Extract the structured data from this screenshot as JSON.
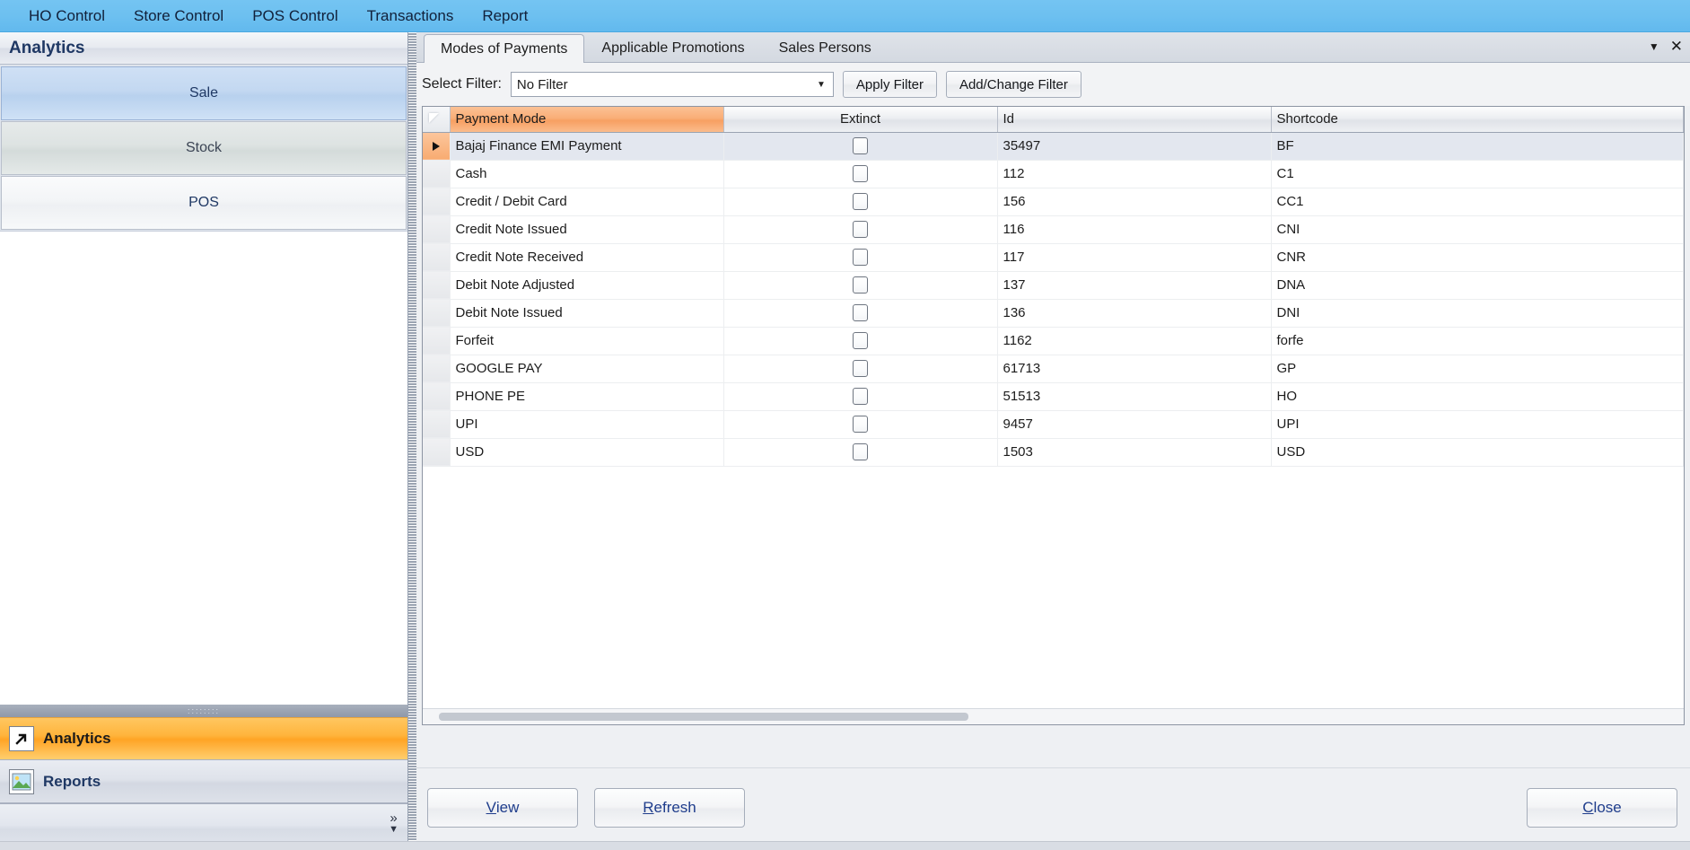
{
  "menubar": {
    "items": [
      {
        "label": "HO Control"
      },
      {
        "label": "Store Control"
      },
      {
        "label": "POS Control"
      },
      {
        "label": "Transactions"
      },
      {
        "label": "Report"
      }
    ]
  },
  "sidebar": {
    "title": "Analytics",
    "nav": [
      {
        "label": "Sale",
        "state": "selected"
      },
      {
        "label": "Stock",
        "state": "normal"
      },
      {
        "label": "POS",
        "state": "normal"
      }
    ],
    "panels": [
      {
        "label": "Analytics",
        "icon": "arrow-up-right-icon",
        "state": "active"
      },
      {
        "label": "Reports",
        "icon": "picture-icon",
        "state": "inactive"
      }
    ],
    "overflow_icon": "double-chevron-right-icon",
    "overflow_dropdown_icon": "chevron-down-icon"
  },
  "tabs": {
    "items": [
      {
        "label": "Modes of Payments",
        "active": true
      },
      {
        "label": "Applicable Promotions",
        "active": false
      },
      {
        "label": "Sales Persons",
        "active": false
      }
    ],
    "window_controls": [
      {
        "icon": "chevron-down-icon",
        "glyph": "▼"
      },
      {
        "icon": "close-icon",
        "glyph": "✕"
      }
    ]
  },
  "filter_bar": {
    "label": "Select Filter:",
    "select_value": "No Filter",
    "select_placeholder": "No Filter",
    "dropdown_icon": "chevron-down-icon",
    "apply_label": "Apply Filter",
    "add_change_label": "Add/Change Filter"
  },
  "grid": {
    "columns": [
      {
        "label": "Payment Mode",
        "align": "left",
        "accent": true
      },
      {
        "label": "Extinct",
        "align": "center",
        "accent": false
      },
      {
        "label": "Id",
        "align": "left",
        "accent": false
      },
      {
        "label": "Shortcode",
        "align": "left",
        "accent": false
      }
    ],
    "rows": [
      {
        "payment_mode": "Bajaj Finance EMI Payment",
        "extinct": false,
        "id": "35497",
        "shortcode": "BF",
        "selected": true
      },
      {
        "payment_mode": "Cash",
        "extinct": false,
        "id": "112",
        "shortcode": "C1",
        "selected": false
      },
      {
        "payment_mode": "Credit / Debit Card",
        "extinct": false,
        "id": "156",
        "shortcode": "CC1",
        "selected": false
      },
      {
        "payment_mode": "Credit Note Issued",
        "extinct": false,
        "id": "116",
        "shortcode": "CNI",
        "selected": false
      },
      {
        "payment_mode": "Credit Note Received",
        "extinct": false,
        "id": "117",
        "shortcode": "CNR",
        "selected": false
      },
      {
        "payment_mode": "Debit Note Adjusted",
        "extinct": false,
        "id": "137",
        "shortcode": "DNA",
        "selected": false
      },
      {
        "payment_mode": "Debit Note Issued",
        "extinct": false,
        "id": "136",
        "shortcode": "DNI",
        "selected": false
      },
      {
        "payment_mode": "Forfeit",
        "extinct": false,
        "id": "1162",
        "shortcode": "forfe",
        "selected": false
      },
      {
        "payment_mode": "GOOGLE PAY",
        "extinct": false,
        "id": "61713",
        "shortcode": "GP",
        "selected": false
      },
      {
        "payment_mode": "PHONE PE",
        "extinct": false,
        "id": "51513",
        "shortcode": "HO",
        "selected": false
      },
      {
        "payment_mode": "UPI",
        "extinct": false,
        "id": "9457",
        "shortcode": "UPI",
        "selected": false
      },
      {
        "payment_mode": "USD",
        "extinct": false,
        "id": "1503",
        "shortcode": "USD",
        "selected": false
      }
    ]
  },
  "footer": {
    "view": {
      "mnemonic": "V",
      "rest": "iew"
    },
    "refresh": {
      "mnemonic": "R",
      "rest": "efresh"
    },
    "close": {
      "mnemonic": "C",
      "rest": "lose"
    }
  },
  "colors": {
    "menubar": "#6dc0f0",
    "header_accent": "#f79f62",
    "panel_active": "#ffb43c",
    "selected_row": "#e3e7ef",
    "link_text": "#1f3d8c"
  }
}
